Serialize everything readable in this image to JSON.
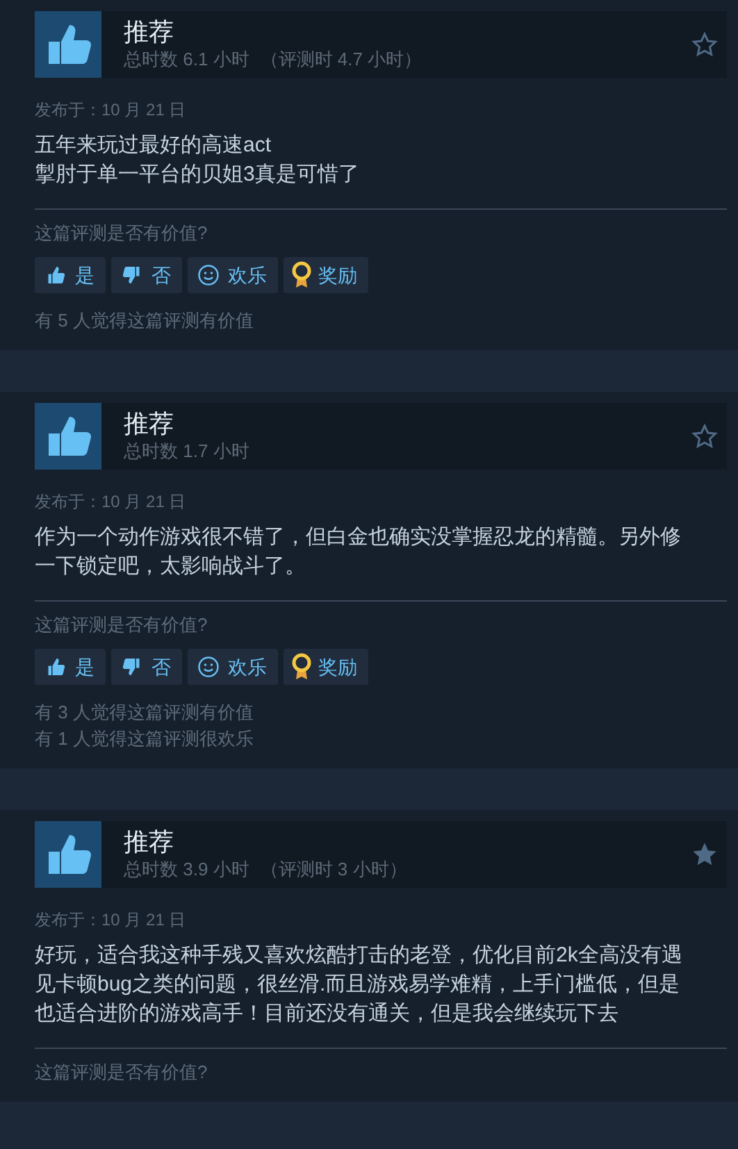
{
  "reviews": [
    {
      "verdict": "推荐",
      "hours": "总时数 6.1 小时",
      "review_hours": "（评测时 4.7 小时）",
      "starred": false,
      "posted": "发布于：10 月 21 日",
      "body": "五年来玩过最好的高速act\n掣肘于单一平台的贝姐3真是可惜了",
      "question": "这篇评测是否有价值?",
      "buttons": [
        {
          "kind": "yes",
          "label": "是"
        },
        {
          "kind": "no",
          "label": "否"
        },
        {
          "kind": "funny",
          "label": "欢乐"
        },
        {
          "kind": "award",
          "label": "奖励"
        }
      ],
      "counts": [
        "有 5 人觉得这篇评测有价值"
      ]
    },
    {
      "verdict": "推荐",
      "hours": "总时数 1.7 小时",
      "starred": false,
      "posted": "发布于：10 月 21 日",
      "body": "作为一个动作游戏很不错了，但白金也确实没掌握忍龙的精髓。另外修一下锁定吧，太影响战斗了。",
      "question": "这篇评测是否有价值?",
      "buttons": [
        {
          "kind": "yes",
          "label": "是"
        },
        {
          "kind": "no",
          "label": "否"
        },
        {
          "kind": "funny",
          "label": "欢乐"
        },
        {
          "kind": "award",
          "label": "奖励"
        }
      ],
      "counts": [
        "有 3 人觉得这篇评测有价值",
        "有 1 人觉得这篇评测很欢乐"
      ]
    },
    {
      "verdict": "推荐",
      "hours": "总时数 3.9 小时",
      "review_hours": "（评测时 3 小时）",
      "starred": true,
      "posted": "发布于：10 月 21 日",
      "body": "好玩，适合我这种手残又喜欢炫酷打击的老登，优化目前2k全高没有遇见卡顿bug之类的问题，很丝滑.而且游戏易学难精，上手门槛低，但是也适合进阶的游戏高手！目前还没有通关，但是我会继续玩下去",
      "question": "这篇评测是否有价值?"
    }
  ]
}
